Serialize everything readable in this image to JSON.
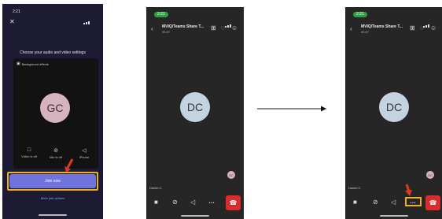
{
  "screen1": {
    "status_time": "2:21",
    "close_icon": "✕",
    "heading": "Choose your audio and video settings",
    "background_effects": "Background effects",
    "avatar_initials": "GC",
    "toggles": [
      {
        "label": "Video is off",
        "icon": "video-off-icon"
      },
      {
        "label": "Mic is off",
        "icon": "mic-off-icon"
      },
      {
        "label": "iPhone",
        "icon": "speaker-icon"
      }
    ],
    "join_button": "Join now",
    "more_options": "More join options"
  },
  "screen2": {
    "status_time": "2:21",
    "title": "MVIQ/Teams Share T...",
    "subtitle": "00:07",
    "avatar_initials": "DC",
    "self_initials": "GC",
    "participant_name": "Daniel C."
  },
  "screen3": {
    "status_time": "2:21",
    "title": "MVIQ/Teams Share T...",
    "subtitle": "00:07",
    "avatar_initials": "DC",
    "self_initials": "GC",
    "participant_name": "Daniel C."
  },
  "annotation_colors": {
    "highlight": "#f2b01e",
    "arrow": "#e03a1e",
    "join_fill": "#6f73de"
  }
}
